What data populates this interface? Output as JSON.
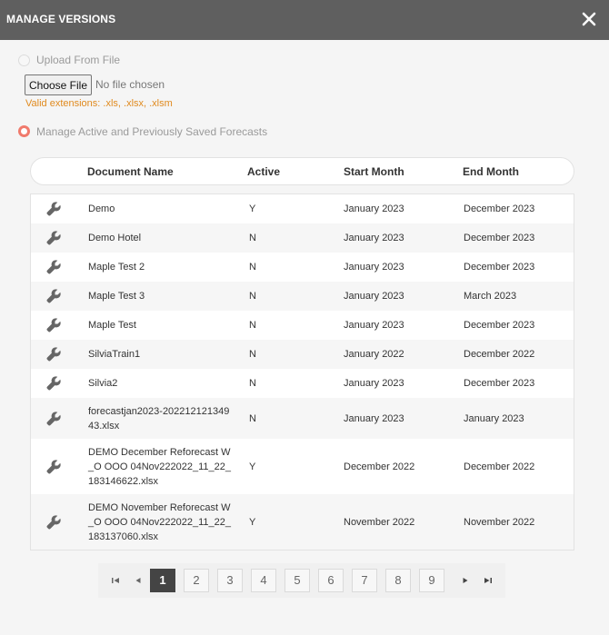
{
  "dialog": {
    "title": "MANAGE VERSIONS"
  },
  "upload": {
    "label": "Upload From File",
    "button_label": "Choose File",
    "file_status": "No file chosen",
    "hint": "Valid extensions: .xls, .xlsx, .xlsm"
  },
  "manage": {
    "label": "Manage Active and Previously Saved Forecasts"
  },
  "table": {
    "columns": [
      "Document Name",
      "Active",
      "Start Month",
      "End Month"
    ],
    "rows": [
      {
        "doc": "Demo",
        "active": "Y",
        "start": "January 2023",
        "end": "December 2023"
      },
      {
        "doc": "Demo Hotel",
        "active": "N",
        "start": "January 2023",
        "end": "December 2023"
      },
      {
        "doc": "Maple Test 2",
        "active": "N",
        "start": "January 2023",
        "end": "December 2023"
      },
      {
        "doc": "Maple Test 3",
        "active": "N",
        "start": "January 2023",
        "end": "March 2023"
      },
      {
        "doc": "Maple Test",
        "active": "N",
        "start": "January 2023",
        "end": "December 2023"
      },
      {
        "doc": "SilviaTrain1",
        "active": "N",
        "start": "January 2022",
        "end": "December 2022"
      },
      {
        "doc": "Silvia2",
        "active": "N",
        "start": "January 2023",
        "end": "December 2023"
      },
      {
        "doc": "forecastjan2023-20221212134943.xlsx",
        "active": "N",
        "start": "January 2023",
        "end": "January 2023"
      },
      {
        "doc": "DEMO December Reforecast W_O OOO 04Nov222022_11_22_183146622.xlsx",
        "active": "Y",
        "start": "December 2022",
        "end": "December 2022"
      },
      {
        "doc": "DEMO November Reforecast W_O OOO 04Nov222022_11_22_183137060.xlsx",
        "active": "Y",
        "start": "November 2022",
        "end": "November 2022"
      }
    ]
  },
  "pagination": {
    "pages": [
      "1",
      "2",
      "3",
      "4",
      "5",
      "6",
      "7",
      "8",
      "9"
    ],
    "current": "1"
  },
  "colors": {
    "titlebar": "#5f5f5f",
    "radio_selected": "#f07a6c",
    "hint": "#e08a1e",
    "current_page": "#444444"
  },
  "icons": {
    "close": "close-icon",
    "row_action": "wrench-icon",
    "first": "first-page-icon",
    "prev": "prev-page-icon",
    "next": "next-page-icon",
    "last": "last-page-icon"
  }
}
